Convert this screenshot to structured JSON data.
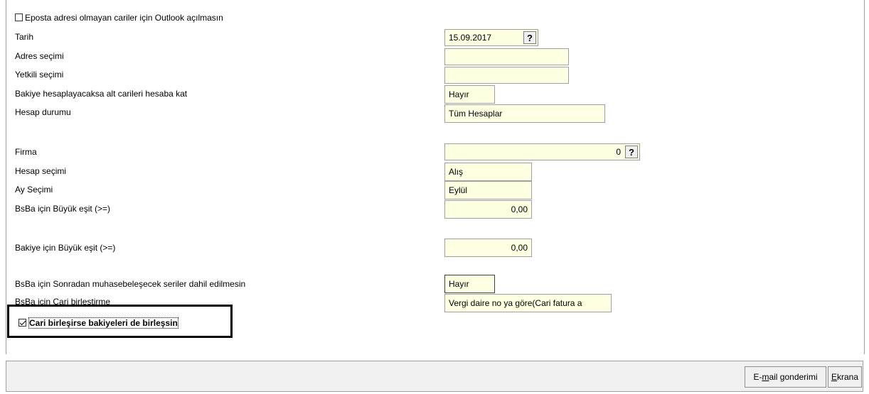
{
  "form": {
    "outlook_checkbox": {
      "label": "Eposta adresi olmayan cariler için Outlook açılmasın",
      "checked": false
    },
    "tarih": {
      "label": "Tarih",
      "value": "15.09.2017",
      "help": "?"
    },
    "adres": {
      "label": "Adres seçimi",
      "value": ""
    },
    "yetkili": {
      "label": "Yetkili seçimi",
      "value": ""
    },
    "alt_cari": {
      "label": "Bakiye hesaplayacaksa alt carileri hesaba kat",
      "value": "Hayır"
    },
    "hesap_durumu": {
      "label": "Hesap durumu",
      "value": "Tüm Hesaplar"
    },
    "firma": {
      "label": "Firma",
      "value": "0",
      "help": "?"
    },
    "hesap_secimi": {
      "label": "Hesap seçimi",
      "value": "Alış"
    },
    "ay_secimi": {
      "label": "Ay Seçimi",
      "value": "Eylül"
    },
    "bsba_buyuk": {
      "label": "BsBa için Büyük eşit (>=)",
      "value": "0,00"
    },
    "bakiye_buyuk": {
      "label": "Bakiye için Büyük eşit (>=)",
      "value": "0,00"
    },
    "bsba_sonradan": {
      "label": "BsBa için Sonradan muhasebeleşecek seriler dahil edilmesin",
      "value": "Hayır"
    },
    "bsba_cari": {
      "label": "BsBa için Cari birleştirme",
      "value": "Vergi daire no ya göre(Cari fatura a"
    },
    "cari_birlesirse": {
      "label": "Cari birleşirse bakiyeleri de birleşsin",
      "checked": true
    }
  },
  "footer": {
    "email_button": {
      "prefix": "E-",
      "accel": "m",
      "rest": "ail gonderimi"
    },
    "ekrana_button": {
      "accel": "E",
      "rest": "krana"
    }
  }
}
